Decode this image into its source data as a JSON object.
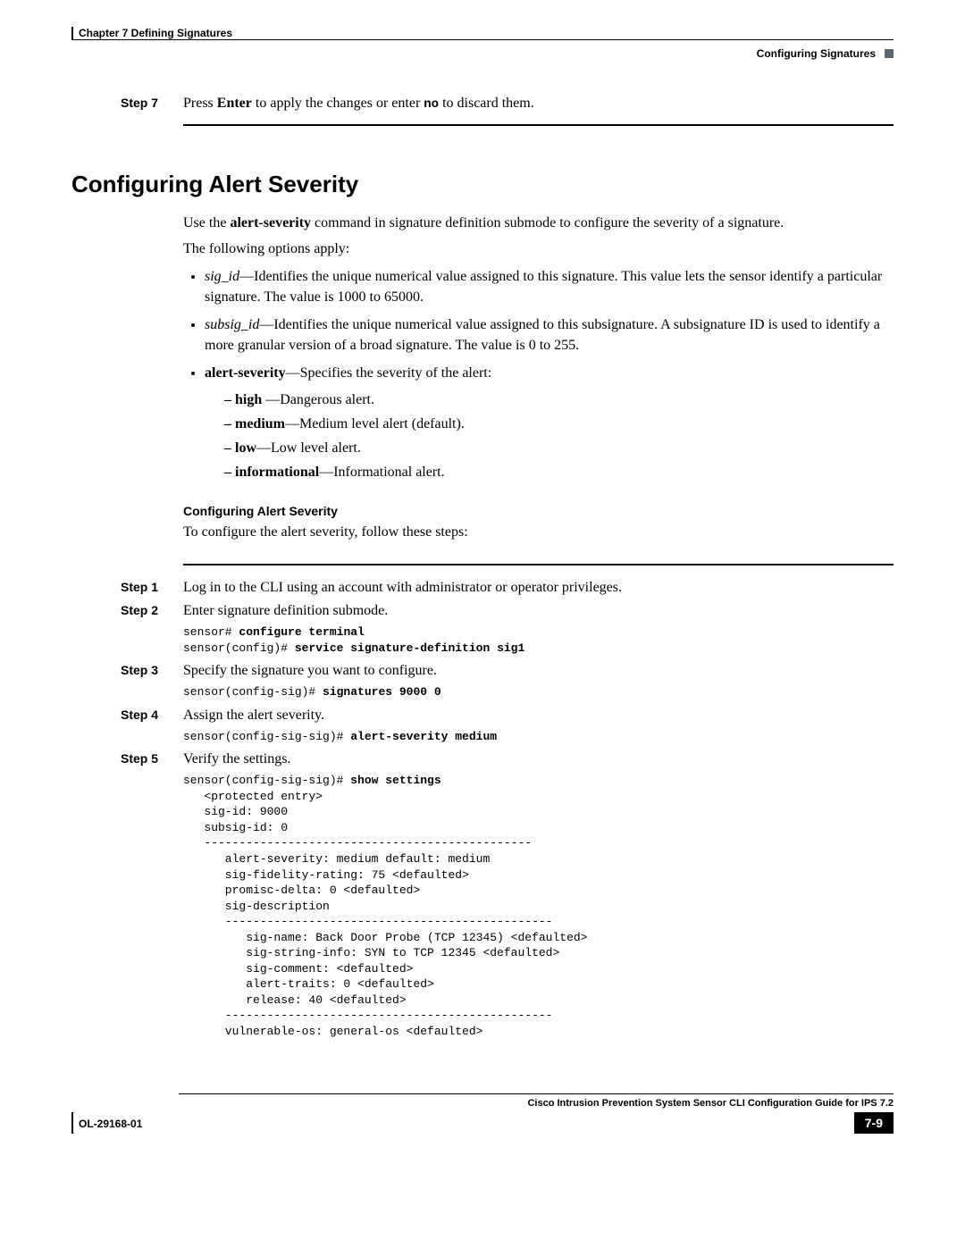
{
  "header": {
    "chapter": "Chapter 7    Defining Signatures",
    "section": "Configuring Signatures"
  },
  "step7": {
    "label": "Step 7",
    "text_pre": "Press ",
    "enter": "Enter",
    "text_mid": " to apply the changes or enter ",
    "no": "no",
    "text_post": " to discard them."
  },
  "section_title": "Configuring Alert Severity",
  "intro": {
    "use_pre": "Use the ",
    "cmd": "alert-severity",
    "use_post": " command in signature definition submode to configure the severity of a signature.",
    "following": "The following options apply:"
  },
  "bullets": {
    "sig_id": {
      "term": "sig_id",
      "desc": "—Identifies the unique numerical value assigned to this signature. This value lets the sensor identify a particular signature. The value is 1000 to 65000."
    },
    "subsig_id": {
      "term": "subsig_id",
      "desc": "—Identifies the unique numerical value assigned to this subsignature. A subsignature ID is used to identify a more granular version of a broad signature. The value is 0 to 255."
    },
    "alert_sev": {
      "term": "alert-severity",
      "desc": "—Specifies the severity of the alert:",
      "high": {
        "k": "high ",
        "v": "—Dangerous alert."
      },
      "medium": {
        "k": "medium",
        "v": "—Medium level alert (default)."
      },
      "low": {
        "k": "low",
        "v": "—Low level alert."
      },
      "info": {
        "k": "informational",
        "v": "—Informational alert."
      }
    }
  },
  "subhead": "Configuring Alert Severity",
  "subhead_text": "To configure the alert severity, follow these steps:",
  "steps": {
    "s1": {
      "label": "Step 1",
      "text": "Log in to the CLI using an account with administrator or operator privileges."
    },
    "s2": {
      "label": "Step 2",
      "text": "Enter signature definition submode.",
      "code_p1": "sensor# ",
      "code_b1": "configure terminal",
      "code_p2": "sensor(config)# ",
      "code_b2": "service signature-definition sig1"
    },
    "s3": {
      "label": "Step 3",
      "text": "Specify the signature you want to configure.",
      "code_p1": "sensor(config-sig)# ",
      "code_b1": "signatures 9000 0"
    },
    "s4": {
      "label": "Step 4",
      "text": "Assign the alert severity.",
      "code_p1": "sensor(config-sig-sig)# ",
      "code_b1": "alert-severity medium"
    },
    "s5": {
      "label": "Step 5",
      "text": "Verify the settings.",
      "code_p1": "sensor(config-sig-sig)# ",
      "code_b1": "show settings",
      "code_rest": "   <protected entry>\n   sig-id: 9000\n   subsig-id: 0\n   -----------------------------------------------\n      alert-severity: medium default: medium\n      sig-fidelity-rating: 75 <defaulted>\n      promisc-delta: 0 <defaulted>\n      sig-description\n      -----------------------------------------------\n         sig-name: Back Door Probe (TCP 12345) <defaulted>\n         sig-string-info: SYN to TCP 12345 <defaulted>\n         sig-comment: <defaulted>\n         alert-traits: 0 <defaulted>\n         release: 40 <defaulted>\n      -----------------------------------------------\n      vulnerable-os: general-os <defaulted>"
    }
  },
  "footer": {
    "guide": "Cisco Intrusion Prevention System Sensor CLI Configuration Guide for IPS 7.2",
    "doc": "OL-29168-01",
    "page": "7-9"
  }
}
